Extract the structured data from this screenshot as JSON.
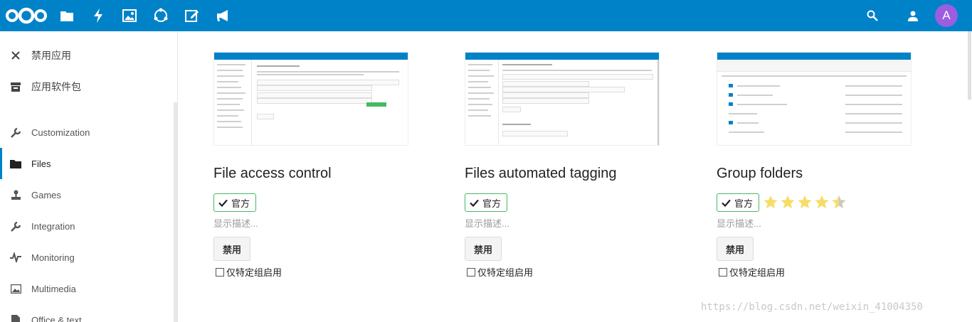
{
  "header": {
    "apps": [
      "files-icon",
      "activity-icon",
      "gallery-icon",
      "circles-icon",
      "notes-icon",
      "announcements-icon"
    ],
    "avatar_letter": "A",
    "brand_color": "#0082c9"
  },
  "sidebar": {
    "top_items": [
      {
        "label": "禁用应用",
        "icon": "close-icon"
      },
      {
        "label": "应用软件包",
        "icon": "archive-icon"
      }
    ],
    "categories": [
      {
        "label": "Customization",
        "icon": "wrench-icon"
      },
      {
        "label": "Files",
        "icon": "folder-icon",
        "active": true
      },
      {
        "label": "Games",
        "icon": "joystick-icon"
      },
      {
        "label": "Integration",
        "icon": "wrench-icon"
      },
      {
        "label": "Monitoring",
        "icon": "pulse-icon"
      },
      {
        "label": "Multimedia",
        "icon": "image-icon"
      },
      {
        "label": "Office & text",
        "icon": "document-icon"
      }
    ]
  },
  "apps": [
    {
      "title": "File access control",
      "badge": "官方",
      "description": "显示描述...",
      "button": "禁用",
      "checkbox": "仅特定组启用",
      "rating": null
    },
    {
      "title": "Files automated tagging",
      "badge": "官方",
      "description": "显示描述...",
      "button": "禁用",
      "checkbox": "仅特定组启用",
      "rating": null
    },
    {
      "title": "Group folders",
      "badge": "官方",
      "description": "显示描述...",
      "button": "禁用",
      "checkbox": "仅特定组启用",
      "rating": 4.5
    }
  ],
  "watermark": "https://blog.csdn.net/weixin_41004350"
}
